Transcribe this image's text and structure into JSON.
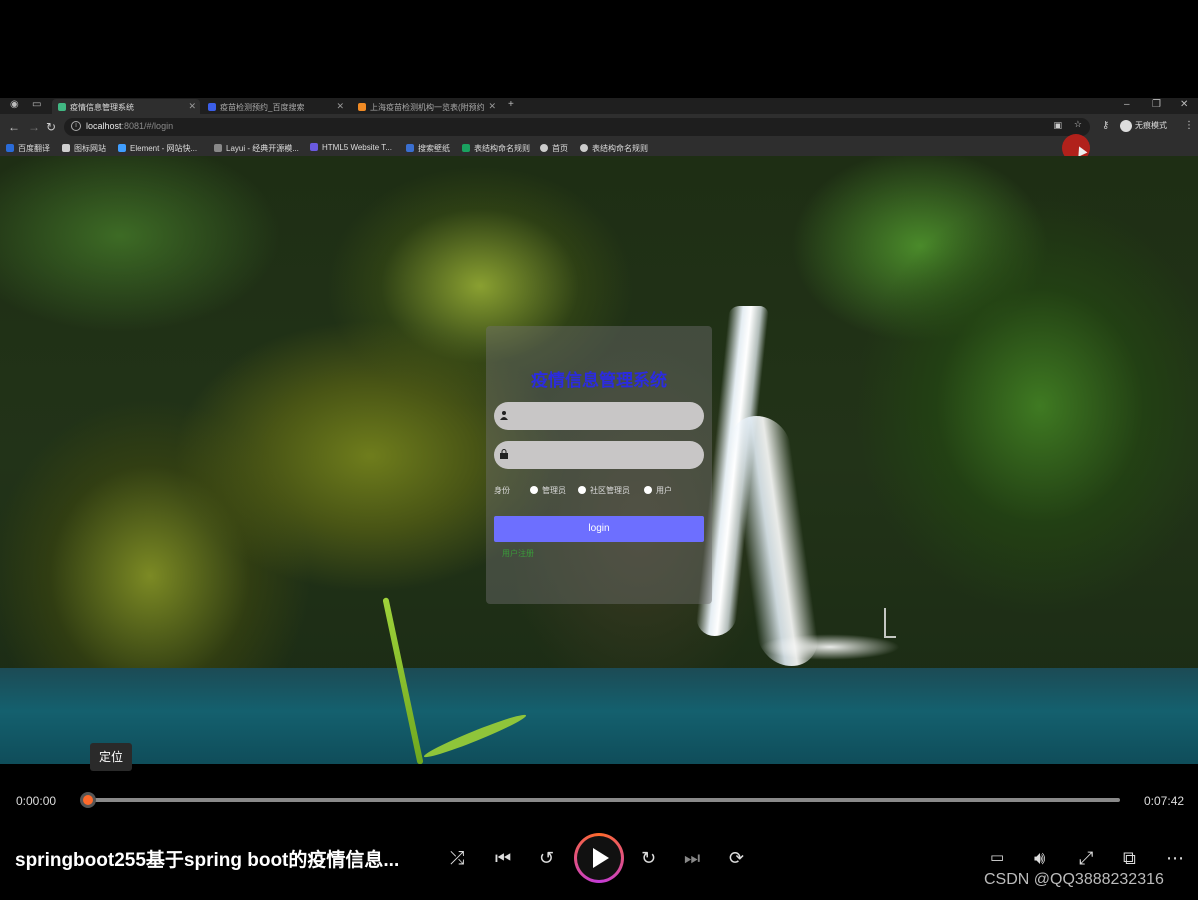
{
  "browser": {
    "tabs": [
      {
        "label": "疫情信息管理系统",
        "active": true
      },
      {
        "label": "疫苗检测预约_百度搜索",
        "active": false
      },
      {
        "label": "上海疫苗检测机构一览表(附预约",
        "active": false
      }
    ],
    "new_tab_label": "+",
    "address": {
      "host": "localhost",
      "path": ":8081/#/login"
    },
    "profile_label": "无痕模式",
    "bookmarks": [
      "百度翻译",
      "图标网站",
      "Element - 网站快...",
      "Layui - 经典开源模...",
      "HTML5 Website T...",
      "搜索壁纸",
      "表结构命名规则",
      "首页",
      "表结构命名规则"
    ]
  },
  "login": {
    "title": "疫情信息管理系统",
    "username_value": "",
    "password_value": "",
    "role_label": "身份",
    "roles": [
      "管理员",
      "社区管理员",
      "用户"
    ],
    "button_label": "login",
    "register_label": "用户注册"
  },
  "player": {
    "tooltip": "定位",
    "current_time": "0:00:00",
    "total_time": "0:07:42",
    "progress": 0.0,
    "title": "springboot255基于spring boot的疫情信息...",
    "watermark": "CSDN @QQ3888232316"
  },
  "colors": {
    "accent": "#ff6a2b",
    "login_button": "#6d6fff",
    "title_blue": "#2b2be0"
  }
}
